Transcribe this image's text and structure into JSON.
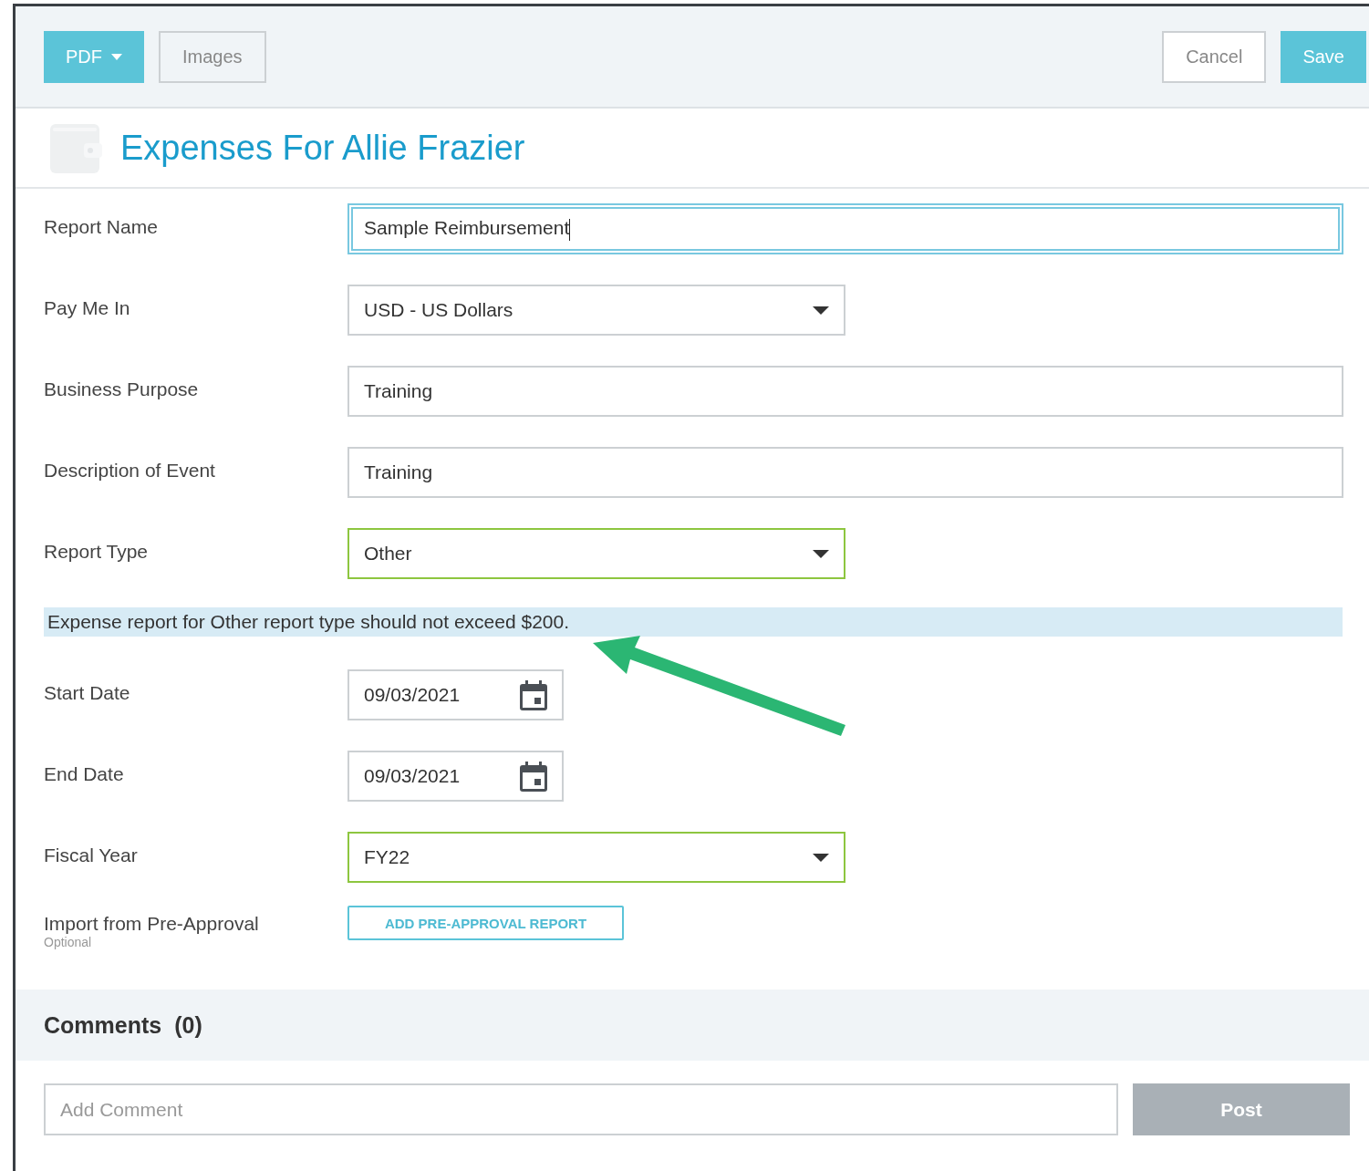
{
  "toolbar": {
    "left_buttons": [
      {
        "label": "PDF",
        "kind": "primary",
        "caret": true
      },
      {
        "label": "Images",
        "kind": "default",
        "caret": false
      }
    ],
    "right_buttons": [
      {
        "label": "Cancel",
        "kind": "default",
        "caret": false
      },
      {
        "label": "Save",
        "kind": "primary",
        "caret": false
      }
    ]
  },
  "title": "Expenses For Allie Frazier",
  "fields": [
    {
      "label": "Report Name",
      "kind": "text",
      "value": "Sample Reimbursement",
      "focused": true,
      "valid": false
    },
    {
      "label": "Pay Me In",
      "kind": "select",
      "value": "USD - US Dollars",
      "focused": false,
      "valid": false
    },
    {
      "label": "Business Purpose",
      "kind": "text",
      "value": "Training",
      "focused": false,
      "valid": false
    },
    {
      "label": "Description of Event",
      "kind": "text",
      "value": "Training",
      "focused": false,
      "valid": false
    },
    {
      "label": "Report Type",
      "kind": "select",
      "value": "Other",
      "focused": false,
      "valid": true
    },
    {
      "kind": "notice",
      "text": "Expense report for Other report type should not exceed $200."
    },
    {
      "label": "Start Date",
      "kind": "date",
      "value": "09/03/2021",
      "focused": false,
      "valid": false
    },
    {
      "label": "End Date",
      "kind": "date",
      "value": "09/03/2021",
      "focused": false,
      "valid": false
    },
    {
      "label": "Fiscal Year",
      "kind": "select",
      "value": "FY22",
      "focused": false,
      "valid": true
    },
    {
      "label": "Import from Pre-Approval",
      "hint": "Optional",
      "kind": "button",
      "value": "ADD PRE-APPROVAL REPORT"
    }
  ],
  "comments": {
    "title": "Comments",
    "count": "(0)",
    "placeholder": "Add Comment",
    "post_button": {
      "label": "Post",
      "disabled": true
    }
  }
}
